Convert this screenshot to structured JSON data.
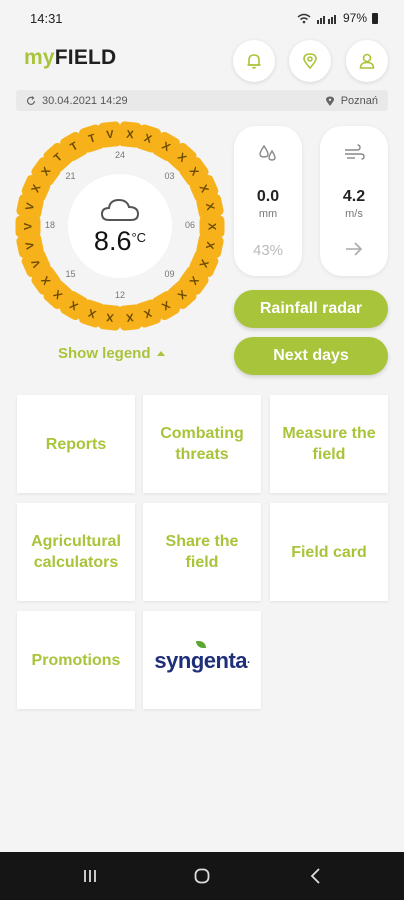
{
  "status_bar": {
    "time": "14:31",
    "battery": "97%"
  },
  "header": {
    "logo_prefix": "my",
    "logo_suffix": "FIELD",
    "icons": [
      "bell-icon",
      "location-pin-icon",
      "user-icon"
    ]
  },
  "info_bar": {
    "updated": "30.04.2021 14:29",
    "location": "Poznań"
  },
  "weather": {
    "temperature": "8.6",
    "temp_unit": "°C",
    "condition_icon": "cloud-icon",
    "hour_labels": [
      "24",
      "03",
      "06",
      "09",
      "12",
      "15",
      "18",
      "21"
    ],
    "hour_segments": [
      "X",
      "X",
      "X",
      "X",
      "X",
      "X",
      "X",
      "X",
      "X",
      "X",
      "X",
      "X",
      "X",
      "X",
      "X",
      "X",
      "X",
      "X",
      "X",
      "X",
      "V",
      "V",
      "V",
      "V",
      "X",
      "X",
      "T",
      "T",
      "T",
      "V"
    ]
  },
  "rainfall": {
    "value": "0.0",
    "unit": "mm",
    "humidity": "43%",
    "icon": "rain-drops-icon"
  },
  "wind": {
    "value": "4.2",
    "unit": "m/s",
    "icon": "wind-icon",
    "direction_icon": "arrow-right-icon"
  },
  "actions": {
    "rainfall_radar": "Rainfall radar",
    "next_days": "Next days"
  },
  "legend_toggle": "Show legend",
  "tiles": {
    "reports": "Reports",
    "combating_threats": "Combating threats",
    "measure_field": "Measure the field",
    "agri_calculators": "Agricultural calculators",
    "share_field": "Share the field",
    "field_card": "Field card",
    "promotions": "Promotions",
    "partner_logo": "syngenta"
  },
  "colors": {
    "accent": "#a8c43a",
    "segment": "#f7b21b",
    "nav": "#151515"
  }
}
